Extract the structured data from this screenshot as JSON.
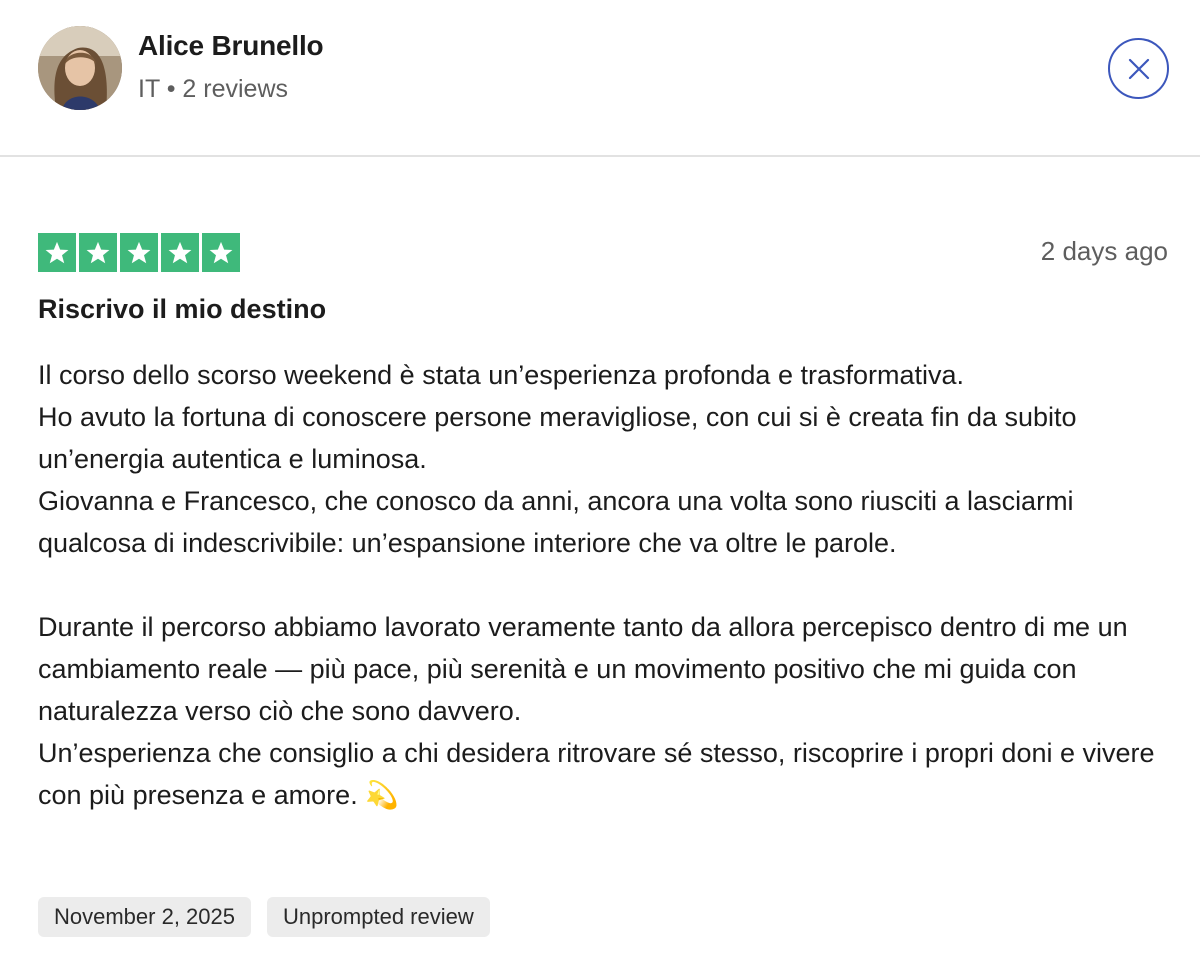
{
  "user": {
    "name": "Alice Brunello",
    "meta": "IT • 2 reviews"
  },
  "review": {
    "rating": 5,
    "rating_max": 5,
    "date_ago": "2 days ago",
    "title": "Riscrivo il mio destino",
    "paragraphs": [
      "Il corso dello scorso weekend è stata un’esperienza profonda e trasformativa.",
      "Ho avuto la fortuna di conoscere persone meravigliose, con cui si è creata fin da subito un’energia autentica e luminosa.",
      "Giovanna e Francesco, che conosco da anni, ancora una volta sono riusciti a lasciarmi qualcosa di indescrivibile: un’espansione interiore che va oltre le parole.",
      "Durante il percorso abbiamo lavorato veramente tanto da allora percepisco dentro di me un cambiamento reale — più pace, più serenità e un movimento positivo che mi guida con naturalezza verso ciò che sono davvero.",
      "Un’esperienza che consiglio a chi desidera ritrovare sé stesso, riscoprire i propri doni e vivere con più presenza e amore. 💫"
    ],
    "tags": [
      "November 2, 2025",
      "Unprompted review"
    ]
  },
  "colors": {
    "star_green": "#3fb97b",
    "close_blue": "#3c57bc"
  },
  "icons": {
    "close": "close-icon",
    "star": "star-icon"
  }
}
